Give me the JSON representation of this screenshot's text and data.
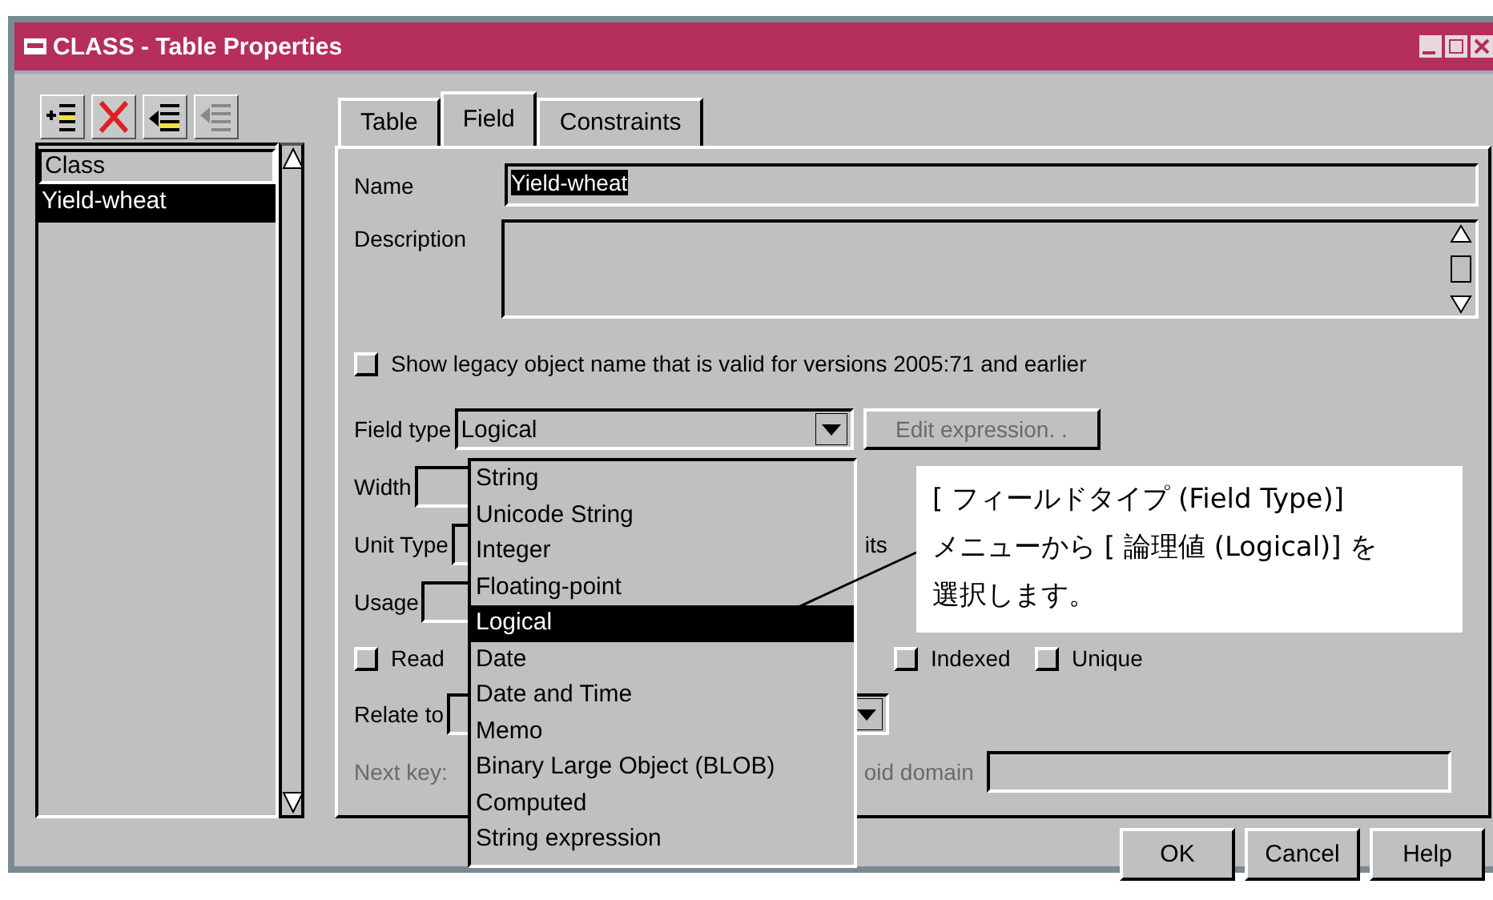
{
  "window": {
    "title": "CLASS - Table Properties"
  },
  "field_list": {
    "items": [
      {
        "label": "Class",
        "selected": false
      },
      {
        "label": "Yield-wheat",
        "selected": true
      }
    ]
  },
  "tabs": [
    {
      "label": "Table",
      "selected": false
    },
    {
      "label": "Field",
      "selected": true
    },
    {
      "label": "Constraints",
      "selected": false
    }
  ],
  "form": {
    "name": {
      "label": "Name",
      "value": "Yield-wheat"
    },
    "description": {
      "label": "Description"
    },
    "legacy": {
      "label": "Show legacy object name that is valid for versions 2005:71 and earlier",
      "checked": false
    },
    "field_type": {
      "label": "Field type",
      "value": "Logical",
      "expanded": true,
      "options": [
        {
          "label": "String",
          "selected": false
        },
        {
          "label": "Unicode String",
          "selected": false
        },
        {
          "label": "Integer",
          "selected": false
        },
        {
          "label": "Floating-point",
          "selected": false
        },
        {
          "label": "Logical",
          "selected": true
        },
        {
          "label": "Date",
          "selected": false
        },
        {
          "label": "Date and Time",
          "selected": false
        },
        {
          "label": "Memo",
          "selected": false
        },
        {
          "label": "Binary Large Object (BLOB)",
          "selected": false
        },
        {
          "label": "Computed",
          "selected": false
        },
        {
          "label": "String expression",
          "selected": false
        }
      ]
    },
    "edit_expression": {
      "label": "Edit expression. .",
      "disabled": true
    },
    "width": {
      "label": "Width"
    },
    "unit_type": {
      "label": "Unit Type",
      "fragment": "its"
    },
    "usage": {
      "label": "Usage"
    },
    "checkboxes": [
      {
        "label": "Read",
        "checked": false
      },
      {
        "label": "Indexed",
        "checked": false
      },
      {
        "label": "Unique",
        "checked": false
      }
    ],
    "relate_to": {
      "label": "Relate to"
    },
    "next_key": {
      "label": "Next key:",
      "disabled": true
    },
    "oid_domain": {
      "label": "oid domain",
      "disabled": true
    }
  },
  "buttons": [
    "OK",
    "Cancel",
    "Help"
  ],
  "callout": {
    "lines": [
      "[ フィールドタイプ (Field Type)]",
      "メニューから [ 論理値 (Logical)] を",
      "選択します。"
    ]
  }
}
